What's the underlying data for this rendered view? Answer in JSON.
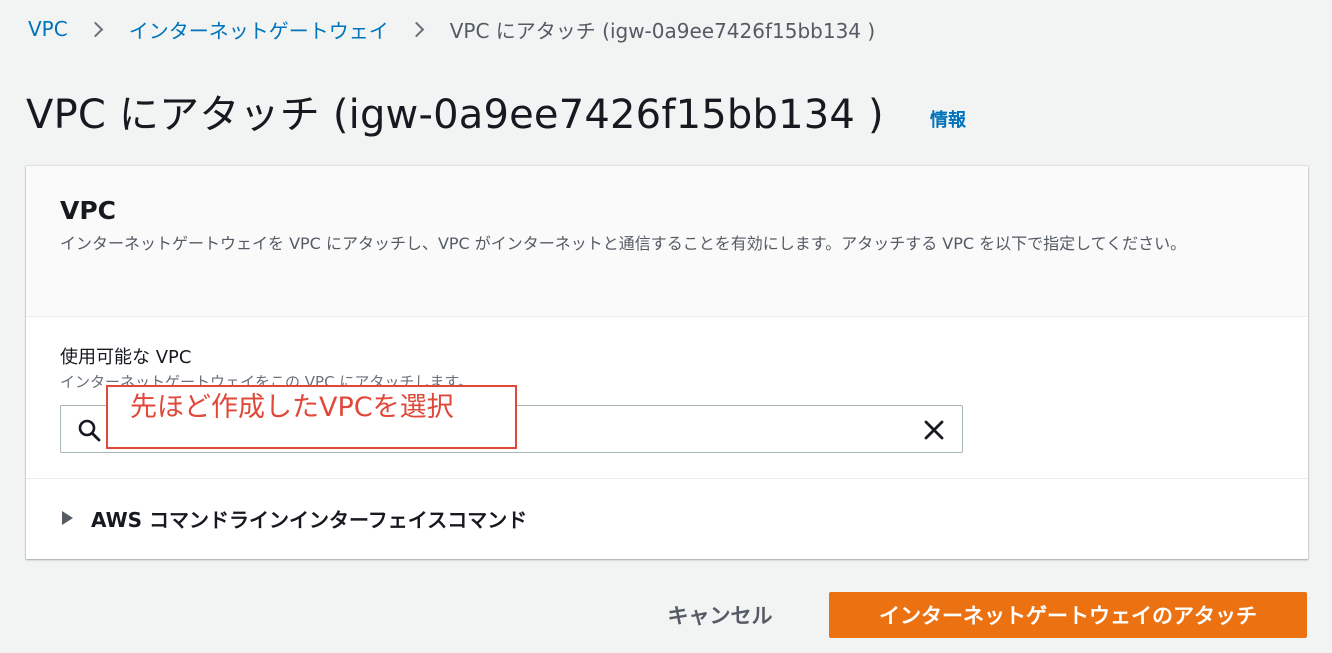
{
  "breadcrumb": {
    "items": [
      "VPC",
      "インターネットゲートウェイ"
    ],
    "current": "VPC にアタッチ (igw-0a9ee7426f15bb134 )"
  },
  "header": {
    "title": "VPC にアタッチ (igw-0a9ee7426f15bb134 )",
    "info_label": "情報"
  },
  "panel": {
    "title": "VPC",
    "description": "インターネットゲートウェイを VPC にアタッチし、VPC がインターネットと通信することを有効にします。アタッチする VPC を以下で指定してください。",
    "field": {
      "label": "使用可能な VPC",
      "hint": "インターネットゲートウェイをこの VPC にアタッチします。",
      "value": "",
      "placeholder": ""
    },
    "expander_label": "AWS コマンドラインインターフェイスコマンド"
  },
  "annotation": {
    "text": "先ほど作成したVPCを選択",
    "color": "#e0483a"
  },
  "actions": {
    "cancel_label": "キャンセル",
    "attach_label": "インターネットゲートウェイのアタッチ"
  },
  "colors": {
    "link": "#0073bb",
    "primary_button": "#ec7211",
    "background": "#f2f3f3"
  },
  "icons": {
    "search": "search-icon",
    "clear": "close-icon",
    "expander": "caret-right-icon",
    "breadcrumb_separator": "chevron-right-icon"
  }
}
